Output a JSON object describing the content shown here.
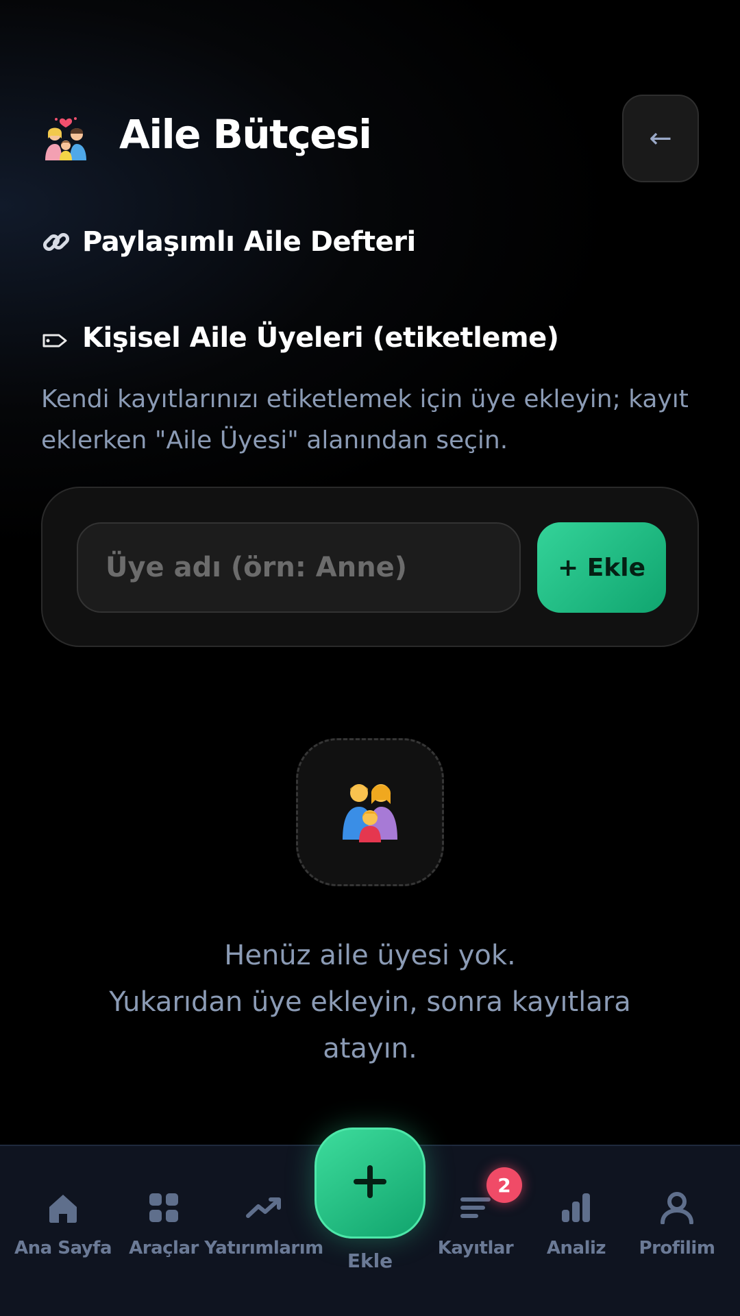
{
  "header": {
    "title": "Aile Bütçesi",
    "back_label": "←",
    "emoji_icon": "family-couple-heart-icon"
  },
  "shared_section": {
    "icon": "link-icon",
    "title": "Paylaşımlı Aile Defteri"
  },
  "members_section": {
    "icon": "label-tag-icon",
    "title": "Kişisel Aile Üyeleri (etiketleme)",
    "description": "Kendi kayıtlarınızı etiketlemek için üye ekleyin; kayıt eklerken \"Aile Üyesi\" alanından seçin."
  },
  "member_form": {
    "placeholder": "Üye adı (örn: Anne)",
    "value": "",
    "add_label": "+ Ekle"
  },
  "empty_state": {
    "icon": "family-icon",
    "line1": "Henüz aile üyesi yok.",
    "line2": "Yukarıdan üye ekleyin, sonra kayıtlara",
    "line3": "atayın."
  },
  "nav": {
    "items": [
      {
        "label": "Ana Sayfa",
        "icon": "home-icon"
      },
      {
        "label": "Araçlar",
        "icon": "grid-icon"
      },
      {
        "label": "Yatırımlarım",
        "icon": "trend-up-icon"
      },
      {
        "label": "Kayıtlar",
        "icon": "list-icon"
      },
      {
        "label": "Analiz",
        "icon": "bar-chart-icon"
      },
      {
        "label": "Profilim",
        "icon": "user-icon"
      }
    ],
    "fab_label": "Ekle",
    "badge_count": "2"
  },
  "colors": {
    "accent": "#34d399",
    "badge": "#f04b67",
    "muted_text": "#8b9bb5",
    "nav_text": "#6b7a96"
  }
}
